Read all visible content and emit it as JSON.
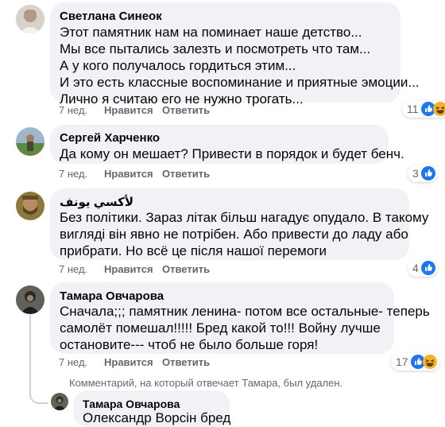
{
  "comments": [
    {
      "author": "Светлана Синеок",
      "lines": [
        "Этот памятник нам на поминает наше детство...",
        "Мы все пытались залезть и посмотреть что там...",
        "А у кого получалось гордиться этим...",
        "И это есть классные воспоминание и приятные эмоции...",
        "Лично я считаю его не нужно трогать..."
      ],
      "time": "7 нед.",
      "like_label": "Нравится",
      "reply_label": "Ответить",
      "reaction_count": "11",
      "reactions": [
        "like-icon",
        "haha-icon"
      ]
    },
    {
      "author": "Сергей Харченко",
      "lines": [
        "Да кому он мешает? Привести в порядок и будет бенч."
      ],
      "time": "7 нед.",
      "like_label": "Нравится",
      "reply_label": "Ответить",
      "reaction_count": "3",
      "reactions": [
        "like-icon"
      ]
    },
    {
      "author": "لأكسي يونف",
      "lines": [
        "Без політики. Зараз літак більш нагадує опудало. В такому",
        "вигляді він явно не потрібен. Або привести до ладу або",
        "прибрати. Но всё це після нашої перемоги"
      ],
      "time": "7 нед.",
      "like_label": "Нравится",
      "reply_label": "Ответить",
      "reaction_count": "4",
      "reactions": [
        "like-icon"
      ]
    },
    {
      "author": "Тамара Овчарова",
      "lines": [
        "Сначала;;; памятник ленина- потом все остальные- теперь",
        "самолёт помешал!!!!! Бред какой то!!! Войну лучше",
        "остановите--- чтоб не было больше горя!"
      ],
      "time": "7 нед.",
      "like_label": "Нравится",
      "reply_label": "Ответить",
      "reaction_count": "17",
      "reactions": [
        "like-icon",
        "haha-icon"
      ]
    }
  ],
  "deleted_notice": "Комментарий, на который отвечает Тамара, был удален.",
  "reply": {
    "author": "Тамара Овчарова",
    "text": "Олександр Ворсін бред"
  },
  "colors": {
    "bubble": "#f0f2f5",
    "meta_text": "#65676b",
    "like_blue": "#1877f2",
    "haha_yellow": "#f7b125"
  }
}
